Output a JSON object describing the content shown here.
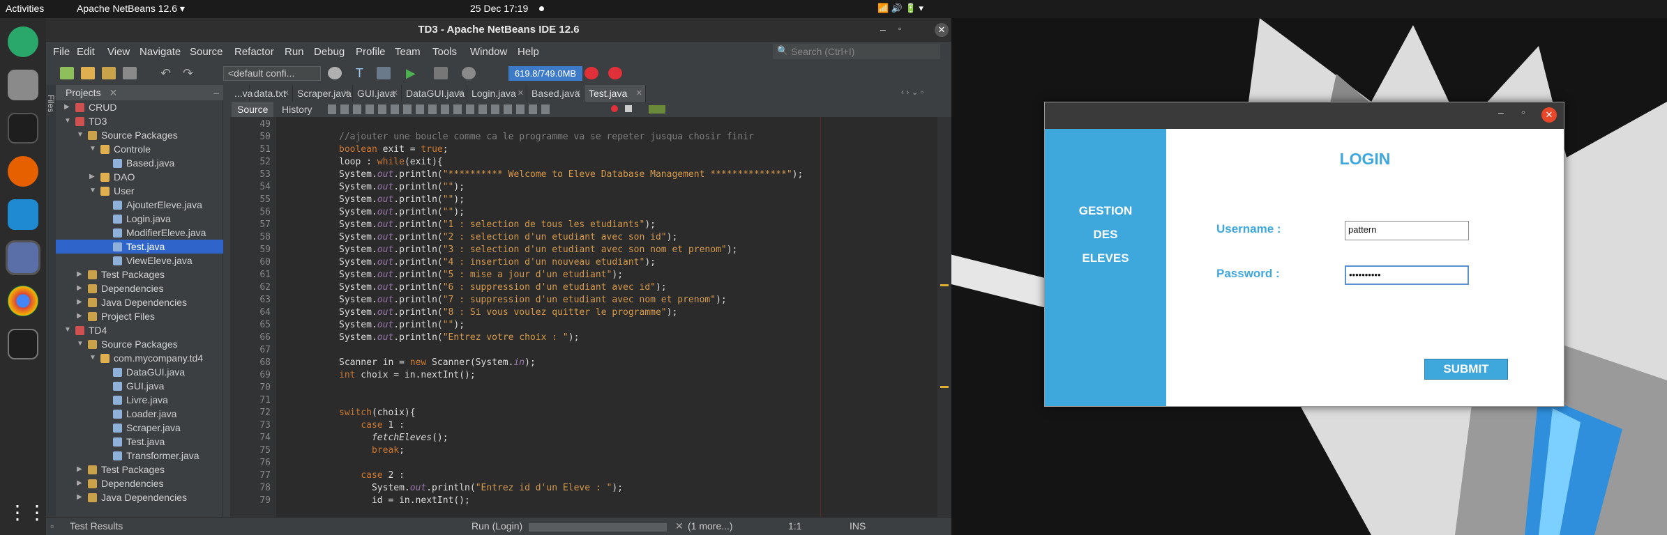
{
  "topbar": {
    "activities": "Activities",
    "app_menu": "Apache NetBeans 12.6 ▾",
    "clock": "25 Dec  17:19"
  },
  "netbeans": {
    "title": "TD3 - Apache NetBeans IDE 12.6",
    "menu": [
      "File",
      "Edit",
      "View",
      "Navigate",
      "Source",
      "Refactor",
      "Run",
      "Debug",
      "Profile",
      "Team",
      "Tools",
      "Window",
      "Help"
    ],
    "search_placeholder": "Search (Ctrl+I)",
    "config": "<default confi...",
    "memory": "619.8/749.0MB",
    "projects_tab": "Projects",
    "files_tab": "Files",
    "tree": [
      {
        "label": "CRUD",
        "depth": 0,
        "icon": "project-icon",
        "arrow": "▶"
      },
      {
        "label": "TD3",
        "depth": 0,
        "icon": "project-icon",
        "arrow": "▼"
      },
      {
        "label": "Source Packages",
        "depth": 1,
        "icon": "folder-icon",
        "arrow": "▼"
      },
      {
        "label": "Controle",
        "depth": 2,
        "icon": "package-icon",
        "arrow": "▼"
      },
      {
        "label": "Based.java",
        "depth": 3,
        "icon": "java-file-icon",
        "arrow": ""
      },
      {
        "label": "DAO",
        "depth": 2,
        "icon": "package-icon",
        "arrow": "▶"
      },
      {
        "label": "User",
        "depth": 2,
        "icon": "package-icon",
        "arrow": "▼"
      },
      {
        "label": "AjouterEleve.java",
        "depth": 3,
        "icon": "java-file-icon",
        "arrow": ""
      },
      {
        "label": "Login.java",
        "depth": 3,
        "icon": "java-file-icon",
        "arrow": ""
      },
      {
        "label": "ModifierEleve.java",
        "depth": 3,
        "icon": "java-file-icon",
        "arrow": ""
      },
      {
        "label": "Test.java",
        "depth": 3,
        "icon": "java-file-icon",
        "arrow": "",
        "selected": true
      },
      {
        "label": "ViewEleve.java",
        "depth": 3,
        "icon": "java-file-icon",
        "arrow": ""
      },
      {
        "label": "Test Packages",
        "depth": 1,
        "icon": "folder-icon",
        "arrow": "▶"
      },
      {
        "label": "Dependencies",
        "depth": 1,
        "icon": "folder-icon",
        "arrow": "▶"
      },
      {
        "label": "Java Dependencies",
        "depth": 1,
        "icon": "folder-icon",
        "arrow": "▶"
      },
      {
        "label": "Project Files",
        "depth": 1,
        "icon": "folder-icon",
        "arrow": "▶"
      },
      {
        "label": "TD4",
        "depth": 0,
        "icon": "project-icon",
        "arrow": "▼"
      },
      {
        "label": "Source Packages",
        "depth": 1,
        "icon": "folder-icon",
        "arrow": "▼"
      },
      {
        "label": "com.mycompany.td4",
        "depth": 2,
        "icon": "package-icon",
        "arrow": "▼"
      },
      {
        "label": "DataGUI.java",
        "depth": 3,
        "icon": "java-file-icon",
        "arrow": ""
      },
      {
        "label": "GUI.java",
        "depth": 3,
        "icon": "java-file-icon",
        "arrow": ""
      },
      {
        "label": "Livre.java",
        "depth": 3,
        "icon": "java-file-icon",
        "arrow": ""
      },
      {
        "label": "Loader.java",
        "depth": 3,
        "icon": "java-file-icon",
        "arrow": ""
      },
      {
        "label": "Scraper.java",
        "depth": 3,
        "icon": "java-file-icon",
        "arrow": ""
      },
      {
        "label": "Test.java",
        "depth": 3,
        "icon": "java-file-icon",
        "arrow": ""
      },
      {
        "label": "Transformer.java",
        "depth": 3,
        "icon": "java-file-icon",
        "arrow": ""
      },
      {
        "label": "Test Packages",
        "depth": 1,
        "icon": "folder-icon",
        "arrow": "▶"
      },
      {
        "label": "Dependencies",
        "depth": 1,
        "icon": "folder-icon",
        "arrow": "▶"
      },
      {
        "label": "Java Dependencies",
        "depth": 1,
        "icon": "folder-icon",
        "arrow": "▶"
      }
    ],
    "tabs": [
      {
        "label": "...va"
      },
      {
        "label": "data.txt"
      },
      {
        "label": "Scraper.java"
      },
      {
        "label": "GUI.java"
      },
      {
        "label": "DataGUI.java"
      },
      {
        "label": "Login.java"
      },
      {
        "label": "Based.java"
      },
      {
        "label": "Test.java",
        "active": true
      }
    ],
    "source_tab": "Source",
    "history_tab": "History",
    "code": [
      {
        "n": "49",
        "t": ""
      },
      {
        "n": "50",
        "t": "//ajouter une boucle comme ca le programme va se repeter jusqua chosir finir",
        "cls": "cm"
      },
      {
        "n": "51",
        "t": "boolean exit = true;"
      },
      {
        "n": "52",
        "t": "loop : while(exit){"
      },
      {
        "n": "53",
        "t": "System.out.println(\"********** Welcome to Eleve Database Management **************\");"
      },
      {
        "n": "54",
        "t": "System.out.println(\"\");"
      },
      {
        "n": "55",
        "t": "System.out.println(\"\");"
      },
      {
        "n": "56",
        "t": "System.out.println(\"\");"
      },
      {
        "n": "57",
        "t": "System.out.println(\"1 : selection de tous les etudiants\");"
      },
      {
        "n": "58",
        "t": "System.out.println(\"2 : selection d'un etudiant avec son id\");"
      },
      {
        "n": "59",
        "t": "System.out.println(\"3 : selection d'un etudiant avec son nom et prenom\");"
      },
      {
        "n": "60",
        "t": "System.out.println(\"4 : insertion d'un nouveau etudiant\");"
      },
      {
        "n": "61",
        "t": "System.out.println(\"5 : mise a jour d'un etudiant\");"
      },
      {
        "n": "62",
        "t": "System.out.println(\"6 : suppression d'un etudiant avec id\");"
      },
      {
        "n": "63",
        "t": "System.out.println(\"7 : suppression d'un etudiant avec nom et prenom\");"
      },
      {
        "n": "64",
        "t": "System.out.println(\"8 : Si vous voulez quitter le programme\");"
      },
      {
        "n": "65",
        "t": "System.out.println(\"\");"
      },
      {
        "n": "66",
        "t": "System.out.println(\"Entrez votre choix : \");"
      },
      {
        "n": "67",
        "t": ""
      },
      {
        "n": "68",
        "t": "Scanner in = new Scanner(System.in);"
      },
      {
        "n": "69",
        "t": "int choix = in.nextInt();"
      },
      {
        "n": "70",
        "t": ""
      },
      {
        "n": "71",
        "t": ""
      },
      {
        "n": "72",
        "t": "switch(choix){"
      },
      {
        "n": "73",
        "t": "    case 1 :"
      },
      {
        "n": "74",
        "t": "      fetchEleves();"
      },
      {
        "n": "75",
        "t": "      break;"
      },
      {
        "n": "76",
        "t": ""
      },
      {
        "n": "77",
        "t": "    case 2 :"
      },
      {
        "n": "78",
        "t": "      System.out.println(\"Entrez id d'un Eleve : \");"
      },
      {
        "n": "79",
        "t": "      id = in.nextInt();"
      }
    ],
    "status": {
      "test_results": "Test Results",
      "run": "Run (Login)",
      "more": "(1 more...)",
      "position": "1:1",
      "mode": "INS"
    }
  },
  "login": {
    "side": [
      "GESTION",
      "DES",
      "ELEVES"
    ],
    "heading": "LOGIN",
    "username_label": "Username :",
    "username_value": "pattern",
    "password_label": "Password :",
    "password_value": "••••••••••",
    "submit": "SUBMIT"
  },
  "colors": {
    "accent": "#3ea7dc",
    "ide_bg": "#2b2b2b",
    "memory": "#3d7bc9"
  }
}
